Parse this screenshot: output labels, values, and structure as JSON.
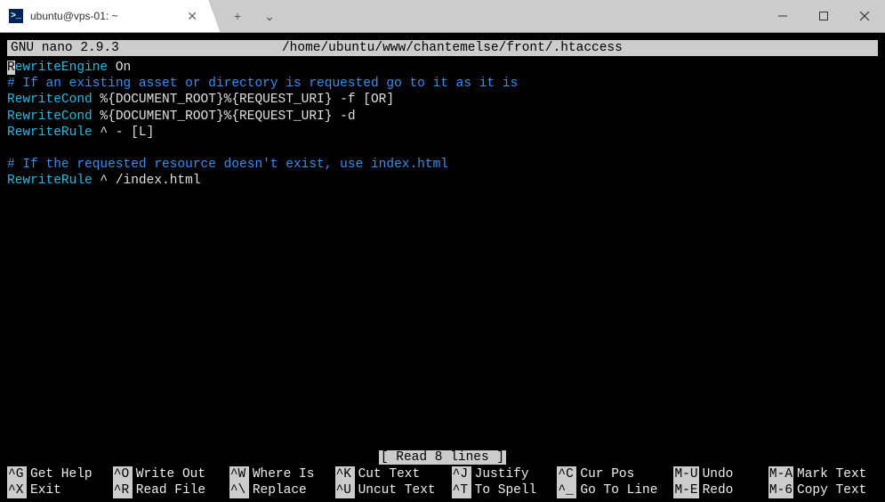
{
  "window": {
    "tab_title": "ubuntu@vps-01: ~",
    "add_tab": "+",
    "dropdown": "⌄"
  },
  "nano": {
    "version": "GNU nano 2.9.3",
    "filename": "/home/ubuntu/www/chantemelse/front/.htaccess",
    "status": "[ Read 8 lines ]"
  },
  "content": {
    "l1_keyword": "RewriteEngine",
    "l1_rest": " On",
    "l2_comment": "# If an existing asset or directory is requested go to it as it is",
    "l3_keyword": "RewriteCond",
    "l3_rest": " %{DOCUMENT_ROOT}%{REQUEST_URI} -f [OR]",
    "l4_keyword": "RewriteCond",
    "l4_rest": " %{DOCUMENT_ROOT}%{REQUEST_URI} -d",
    "l5_keyword": "RewriteRule",
    "l5_rest": " ^ - [L]",
    "l7_comment": "# If the requested resource doesn't exist, use index.html",
    "l8_keyword": "RewriteRule",
    "l8_rest": " ^ /index.html"
  },
  "shortcuts": [
    {
      "key": "^G",
      "label": "Get Help"
    },
    {
      "key": "^O",
      "label": "Write Out"
    },
    {
      "key": "^W",
      "label": "Where Is"
    },
    {
      "key": "^K",
      "label": "Cut Text"
    },
    {
      "key": "^J",
      "label": "Justify"
    },
    {
      "key": "^C",
      "label": "Cur Pos"
    },
    {
      "key": "M-U",
      "label": "Undo"
    },
    {
      "key": "M-A",
      "label": "Mark Text"
    },
    {
      "key": "^X",
      "label": "Exit"
    },
    {
      "key": "^R",
      "label": "Read File"
    },
    {
      "key": "^\\",
      "label": "Replace"
    },
    {
      "key": "^U",
      "label": "Uncut Text"
    },
    {
      "key": "^T",
      "label": "To Spell"
    },
    {
      "key": "^_",
      "label": "Go To Line"
    },
    {
      "key": "M-E",
      "label": "Redo"
    },
    {
      "key": "M-6",
      "label": "Copy Text"
    }
  ]
}
